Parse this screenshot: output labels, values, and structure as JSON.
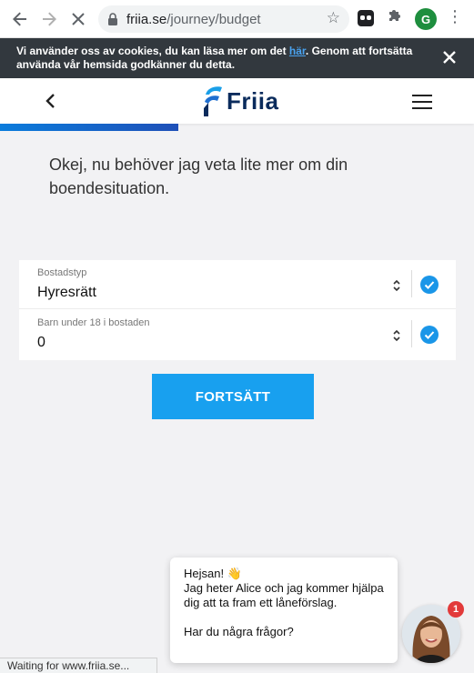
{
  "browser": {
    "url_domain": "friia.se",
    "url_path": "/journey/budget",
    "profile_initial": "G",
    "status_text": "Waiting for www.friia.se..."
  },
  "cookie_banner": {
    "text_before": "Vi använder oss av cookies, du kan läsa mer om det ",
    "link": "här",
    "text_after": ". Genom att fortsätta använda vår hemsida godkänner du detta."
  },
  "header": {
    "logo_text": "Friia"
  },
  "progress": {
    "value_percent": 37.6
  },
  "main": {
    "question": "Okej, nu behöver jag veta lite mer om din boendesituation."
  },
  "form": {
    "fields": [
      {
        "label": "Bostadstyp",
        "value": "Hyresrätt",
        "complete": true
      },
      {
        "label": "Barn under 18 i bostaden",
        "value": "0",
        "complete": true
      }
    ],
    "continue_label": "FORTSÄTT"
  },
  "chat": {
    "greeting": "Hejsan! 👋",
    "message": "Jag heter Alice och jag kommer hjälpa dig att ta fram ett låneförslag.",
    "question": "Har du några frågor?",
    "badge_count": "1"
  },
  "colors": {
    "accent": "#18a0ef",
    "brand_navy": "#0a2b5c",
    "cookie_bg": "#32383e",
    "check": "#1a96e8"
  },
  "icons": [
    "back-arrow-icon",
    "forward-arrow-icon",
    "stop-loading-icon",
    "lock-icon",
    "star-icon",
    "extension-icon",
    "puzzle-icon",
    "more-icon",
    "close-icon",
    "chevron-left-icon",
    "hamburger-icon",
    "select-arrows-icon",
    "check-circle-icon"
  ]
}
